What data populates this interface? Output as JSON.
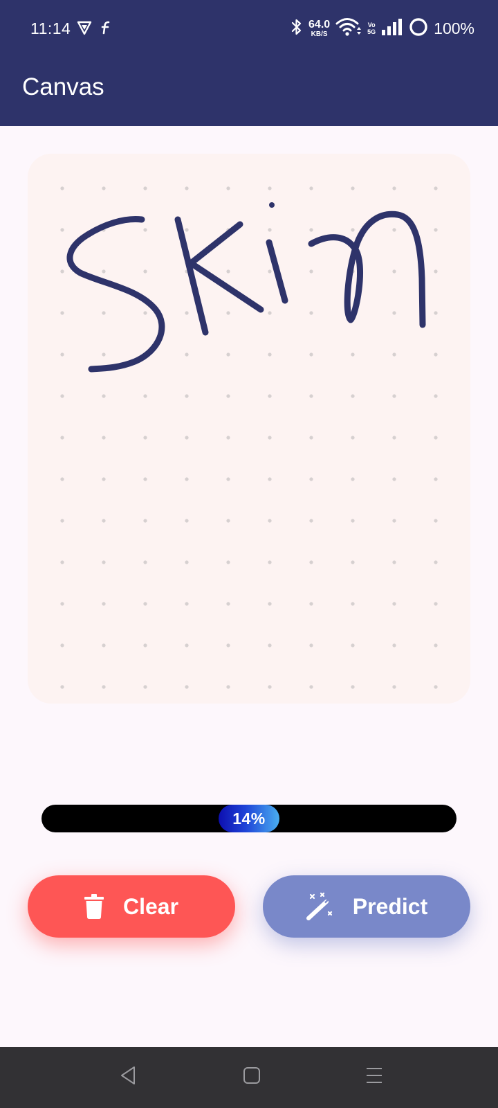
{
  "status_bar": {
    "time": "11:14",
    "net_speed_value": "64.0",
    "net_speed_unit": "KB/S",
    "volte_top": "Vo",
    "volte_bottom": "5G",
    "battery_percent": "100%",
    "icons": [
      "shield-icon",
      "flipkart-icon",
      "bluetooth-icon",
      "wifi-icon",
      "signal-icon",
      "battery-ring-icon"
    ]
  },
  "app_bar": {
    "title": "Canvas",
    "color": "#2e336a"
  },
  "canvas": {
    "background": "#fdf3f2",
    "stroke_color": "#2e336a",
    "drawn_text": "Skin"
  },
  "progress": {
    "value": 0.14,
    "label": "14%"
  },
  "buttons": {
    "clear": {
      "label": "Clear",
      "icon": "trash-icon",
      "color": "#fe5655"
    },
    "predict": {
      "label": "Predict",
      "icon": "magic-wand-icon",
      "color": "#7988c9"
    }
  },
  "nav_bar": {
    "icons": [
      "back-icon",
      "home-icon",
      "menu-icon"
    ]
  }
}
